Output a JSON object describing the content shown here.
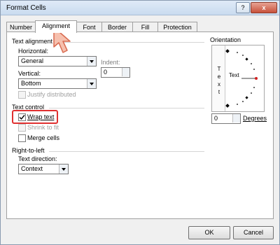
{
  "window": {
    "title": "Format Cells",
    "help": "?",
    "close": "x"
  },
  "tabs": [
    {
      "label": "Number"
    },
    {
      "label": "Alignment"
    },
    {
      "label": "Font"
    },
    {
      "label": "Border"
    },
    {
      "label": "Fill"
    },
    {
      "label": "Protection"
    }
  ],
  "text_alignment": {
    "header": "Text alignment",
    "horizontal_label": "Horizontal:",
    "horizontal_value": "General",
    "indent_label": "Indent:",
    "indent_value": "0",
    "vertical_label": "Vertical:",
    "vertical_value": "Bottom",
    "justify_distributed": "Justify distributed"
  },
  "text_control": {
    "header": "Text control",
    "wrap_text": "Wrap text",
    "wrap_checked": true,
    "shrink_to_fit": "Shrink to fit",
    "merge_cells": "Merge cells"
  },
  "rtl": {
    "header": "Right-to-left",
    "direction_label": "Text direction:",
    "direction_value": "Context"
  },
  "orientation": {
    "header": "Orientation",
    "vertical_letters": [
      "T",
      "e",
      "x",
      "t"
    ],
    "text": "Text",
    "degrees_value": "0",
    "degrees_label": "Degrees"
  },
  "buttons": {
    "ok": "OK",
    "cancel": "Cancel"
  },
  "colors": {
    "highlight": "#e03030",
    "cursor": "#f3b3a0"
  }
}
